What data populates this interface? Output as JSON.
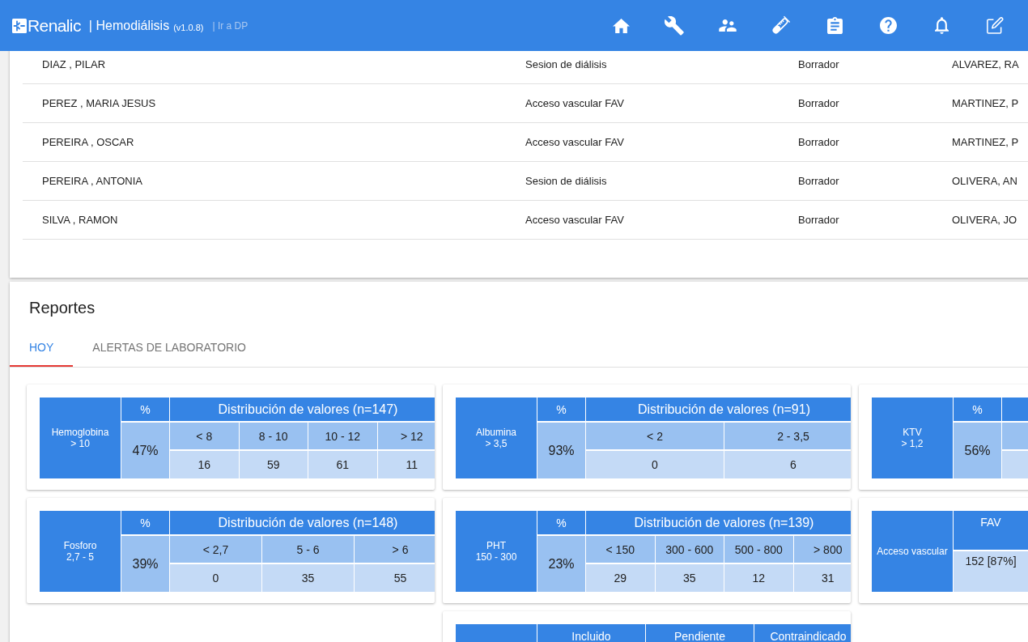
{
  "header": {
    "brand": "Renalic",
    "title": "| Hemodiálisis",
    "version": "(v1.0.8)",
    "link": "| Ir a DP",
    "nav": [
      {
        "kind": "home"
      },
      {
        "kind": "wrench"
      },
      {
        "kind": "people"
      },
      {
        "kind": "test_tube"
      },
      {
        "kind": "clipboard"
      },
      {
        "kind": "help"
      },
      {
        "kind": "bell"
      },
      {
        "kind": "edit"
      }
    ]
  },
  "records": {
    "rows": [
      {
        "cells": [
          "DIAZ , PILAR",
          "Sesion de diálisis",
          "Borrador",
          "ALVAREZ, RA"
        ]
      },
      {
        "cells": [
          "PEREZ , MARIA JESUS",
          "Acceso vascular FAV",
          "Borrador",
          "MARTINEZ, P"
        ]
      },
      {
        "cells": [
          "PEREIRA , OSCAR",
          "Acceso vascular FAV",
          "Borrador",
          "MARTINEZ, P"
        ]
      },
      {
        "cells": [
          "PEREIRA , ANTONIA",
          "Sesion de diálisis",
          "Borrador",
          "OLIVERA, AN"
        ]
      },
      {
        "cells": [
          "SILVA , RAMON",
          "Acceso vascular FAV",
          "Borrador",
          "OLIVERA, JO"
        ]
      }
    ]
  },
  "reports": {
    "title": "Reportes",
    "tabs": [
      {
        "label": "HOY",
        "selected": true
      },
      {
        "label": "ALERTAS DE LABORATORIO",
        "selected": false
      }
    ],
    "columns": [
      {
        "cards": [
          {
            "kind": "distribution",
            "name": "Hemoglobina",
            "target": "> 10",
            "percent_header": "%",
            "percent": "47%",
            "title": "Distribución de valores (n=147)",
            "ranges": [
              "< 8",
              "8 - 10",
              "10 - 12",
              "> 12"
            ],
            "counts": [
              "16",
              "59",
              "61",
              "11"
            ]
          },
          {
            "kind": "distribution",
            "name": "Fosforo",
            "target": "2,7 - 5",
            "percent_header": "%",
            "percent": "39%",
            "title": "Distribución de valores (n=148)",
            "ranges": [
              "< 2,7",
              "5 - 6",
              "> 6"
            ],
            "counts": [
              "0",
              "35",
              "55"
            ]
          }
        ]
      },
      {
        "cards": [
          {
            "kind": "distribution",
            "name": "Albumina",
            "target": "> 3,5",
            "percent_header": "%",
            "percent": "93%",
            "title": "Distribución de valores (n=91)",
            "ranges": [
              "< 2",
              "2 - 3,5"
            ],
            "counts": [
              "0",
              "6"
            ]
          },
          {
            "kind": "distribution",
            "name": "PHT",
            "target": "150 - 300",
            "percent_header": "%",
            "percent": "23%",
            "title": "Distribución de valores (n=139)",
            "ranges": [
              "< 150",
              "300 - 600",
              "500 - 800",
              "> 800"
            ],
            "counts": [
              "29",
              "35",
              "12",
              "31"
            ]
          },
          {
            "kind": "status",
            "columns": [
              "Incluido",
              "Pendiente",
              "Contraindicado"
            ]
          }
        ]
      },
      {
        "cards": [
          {
            "kind": "distribution",
            "name": "KTV",
            "target": "> 1,2",
            "percent_header": "%",
            "percent": "56%"
          },
          {
            "kind": "access",
            "name": "Acceso vascular",
            "columns": [
              {
                "header": "FAV",
                "value": "152 [87%]"
              }
            ]
          }
        ]
      }
    ]
  }
}
